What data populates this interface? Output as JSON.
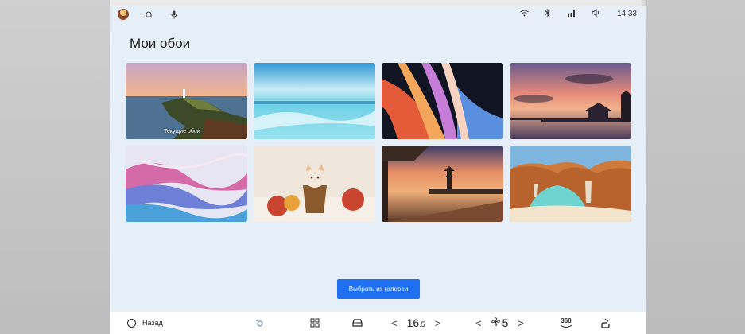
{
  "statusbar": {
    "left_icons": [
      "avatar-icon",
      "bell-icon",
      "mic-icon"
    ],
    "right_icons": [
      "wifi-icon",
      "bluetooth-icon",
      "signal-icon",
      "volume-icon"
    ],
    "time": "14:33"
  },
  "page": {
    "title": "Мои обои"
  },
  "wallpapers": [
    {
      "name": "lighthouse-coast",
      "current": true,
      "caption": "Текущие обои"
    },
    {
      "name": "turquoise-sea",
      "current": false,
      "caption": ""
    },
    {
      "name": "abstract-petals",
      "current": false,
      "caption": ""
    },
    {
      "name": "sunset-pier",
      "current": false,
      "caption": ""
    },
    {
      "name": "silk-waves",
      "current": false,
      "caption": ""
    },
    {
      "name": "kitten-pot",
      "current": false,
      "caption": ""
    },
    {
      "name": "pagoda-terrace",
      "current": false,
      "caption": ""
    },
    {
      "name": "sea-cave",
      "current": false,
      "caption": ""
    }
  ],
  "gallery_button": {
    "label": "Выбрать из галереи"
  },
  "bottombar": {
    "back_label": "Назад",
    "temp_value": "16",
    "temp_decimal": ".5",
    "fan_value": "5",
    "view_360": "360",
    "icons": [
      "home-circle-icon",
      "settings-small-icon",
      "apps-grid-icon",
      "car-icon",
      "fan-icon",
      "360-view-icon",
      "seat-heat-icon"
    ]
  },
  "colors": {
    "accent": "#1f6ff2",
    "screen_bg": "#e6eef8"
  }
}
